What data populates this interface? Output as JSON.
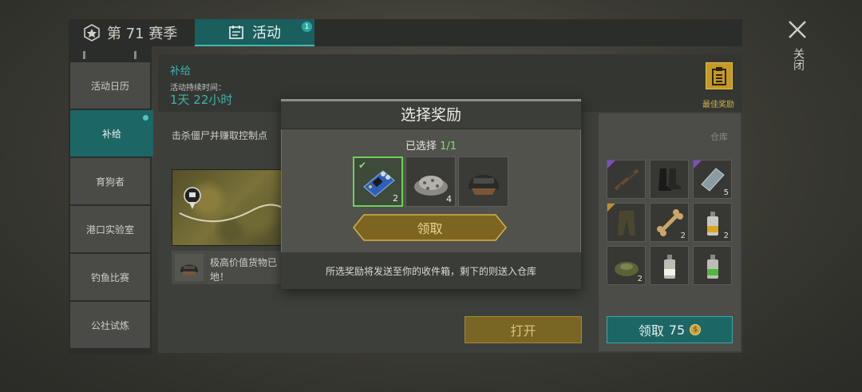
{
  "tabs": {
    "season": "第 71 赛季",
    "activity": "活动",
    "activity_badge": "1"
  },
  "close_label": "关闭",
  "sidebar": {
    "items": [
      {
        "label": "活动日历"
      },
      {
        "label": "补给"
      },
      {
        "label": "育狗者"
      },
      {
        "label": "港口实验室"
      },
      {
        "label": "钓鱼比赛"
      },
      {
        "label": "公社试炼"
      }
    ]
  },
  "event": {
    "title": "补给",
    "duration_label": "活动持续时间：",
    "duration_value": "1天 22小时",
    "best_reward_label": "最佳奖励",
    "description": "击杀僵尸并赚取控制点",
    "note_line1": "极高价值货物已",
    "note_line2": "地！",
    "open_button": "打开"
  },
  "warehouse": {
    "label": "仓库",
    "claim_button": "领取",
    "claim_cost": "75",
    "slots": [
      {
        "icon": "rifle-icon",
        "count": "",
        "rarity": "epic"
      },
      {
        "icon": "boots-icon",
        "count": "",
        "rarity": ""
      },
      {
        "icon": "steel-plate-icon",
        "count": "5",
        "rarity": "epic"
      },
      {
        "icon": "pants-icon",
        "count": "",
        "rarity": "rare"
      },
      {
        "icon": "bone-icon",
        "count": "2",
        "rarity": ""
      },
      {
        "icon": "spray-can-icon",
        "count": "2",
        "rarity": ""
      },
      {
        "icon": "landmine-icon",
        "count": "2",
        "rarity": ""
      },
      {
        "icon": "spray-can-white-icon",
        "count": "",
        "rarity": ""
      },
      {
        "icon": "spray-can-green-icon",
        "count": "",
        "rarity": ""
      }
    ]
  },
  "modal": {
    "title": "选择奖励",
    "selected_label": "已选择",
    "selected_value": "1/1",
    "rewards": [
      {
        "icon": "circuit-board-icon",
        "count": "2",
        "selected": true
      },
      {
        "icon": "gravel-pile-icon",
        "count": "4",
        "selected": false
      },
      {
        "icon": "helmet-icon",
        "count": "",
        "selected": false
      }
    ],
    "claim_button": "领取",
    "footer": "所选奖励将发送至你的收件箱，剩下的则送入仓库"
  },
  "colors": {
    "teal_accent": "#3fb3ab",
    "gold_accent": "#c49a25",
    "select_green": "#7ee06f"
  }
}
